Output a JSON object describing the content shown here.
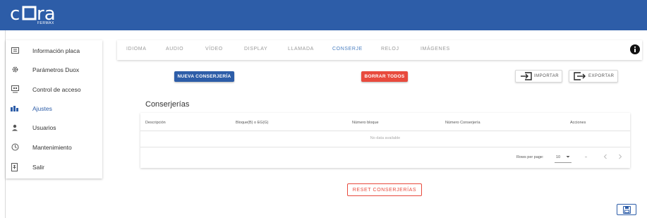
{
  "brand": {
    "logo_text": "cora",
    "logo_sub": "FERMAX",
    "header_color": "#2d5da8"
  },
  "sidebar": {
    "items": [
      {
        "label": "Información placa",
        "icon": "info-card-icon"
      },
      {
        "label": "Parámetros Duox",
        "icon": "gear-icon"
      },
      {
        "label": "Control de acceso",
        "icon": "access-control-icon"
      },
      {
        "label": "Ajustes",
        "icon": "adjustments-icon",
        "active": true
      },
      {
        "label": "Usuarios",
        "icon": "user-icon"
      },
      {
        "label": "Mantenimiento",
        "icon": "maintenance-icon"
      },
      {
        "label": "Salir",
        "icon": "exit-icon"
      }
    ]
  },
  "tabs": [
    {
      "label": "IDIOMA"
    },
    {
      "label": "AUDIO"
    },
    {
      "label": "VÍDEO"
    },
    {
      "label": "DISPLAY"
    },
    {
      "label": "LLAMADA"
    },
    {
      "label": "CONSERJE",
      "active": true
    },
    {
      "label": "RELOJ"
    },
    {
      "label": "IMÁGENES"
    }
  ],
  "actions": {
    "new_label": "NUEVA CONSERJERÍA",
    "delete_all_label": "BORRAR TODOS",
    "import_label": "IMPORTAR",
    "export_label": "EXPORTAR"
  },
  "table": {
    "title": "Conserjerías",
    "columns": [
      "Descripción",
      "Bloque(B) o EG(G)",
      "Número bloque",
      "Número Conserjería",
      "Acciones"
    ],
    "empty_text": "No data available",
    "rows_per_page_label": "Rows per page:",
    "rows_per_page_value": "10",
    "range_text": "–"
  },
  "reset_label": "RESET CONSERJERÍAS",
  "colors": {
    "primary": "#2d5da8",
    "danger": "#e84a3d",
    "active_tab": "#4a7fc1"
  }
}
